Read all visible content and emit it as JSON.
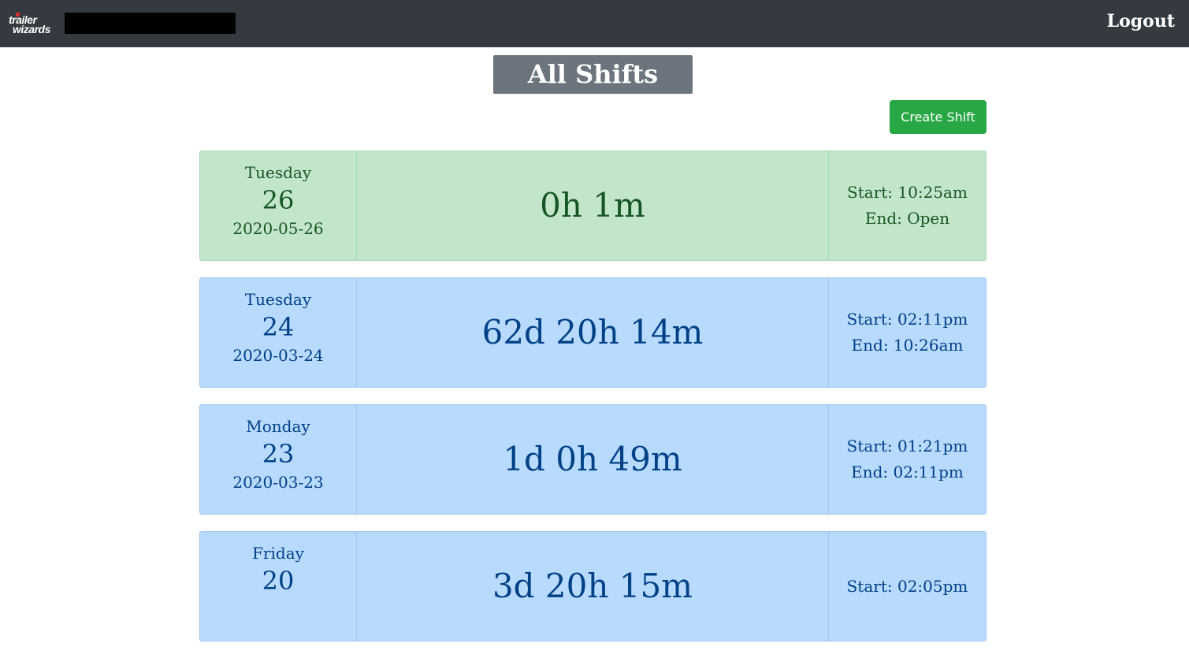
{
  "navbar": {
    "logo_line1": "trailer",
    "logo_line2": "wizards",
    "logout_label": "Logout"
  },
  "page": {
    "title": "All Shifts",
    "create_button_label": "Create Shift"
  },
  "shifts": [
    {
      "weekday": "Tuesday",
      "day": "26",
      "date": "2020-05-26",
      "duration": "0h 1m",
      "start": "Start: 10:25am",
      "end": "End: Open",
      "status": "open"
    },
    {
      "weekday": "Tuesday",
      "day": "24",
      "date": "2020-03-24",
      "duration": "62d 20h 14m",
      "start": "Start: 02:11pm",
      "end": "End: 10:26am",
      "status": "closed"
    },
    {
      "weekday": "Monday",
      "day": "23",
      "date": "2020-03-23",
      "duration": "1d 0h 49m",
      "start": "Start: 01:21pm",
      "end": "End: 02:11pm",
      "status": "closed"
    },
    {
      "weekday": "Friday",
      "day": "20",
      "date": "",
      "duration": "3d 20h 15m",
      "start": "Start: 02:05pm",
      "end": "",
      "status": "closed"
    }
  ],
  "colors": {
    "navbar_bg": "#343a40",
    "title_bg": "#6c757d",
    "create_button_bg": "#28a745",
    "open_shift_bg": "#c3e6cb",
    "open_shift_text": "#155724",
    "closed_shift_bg": "#b8daff",
    "closed_shift_text": "#004085"
  }
}
